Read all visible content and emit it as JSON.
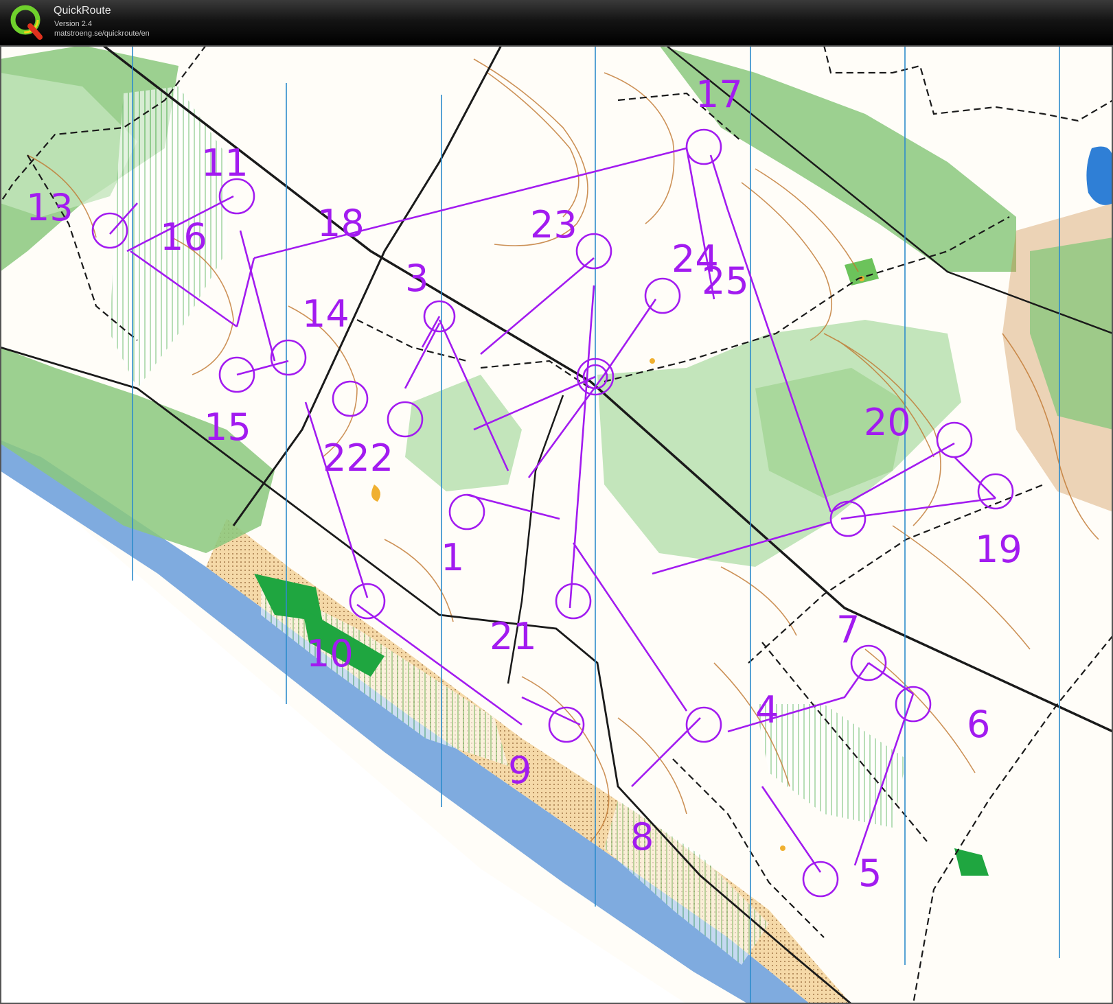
{
  "app": {
    "name": "QuickRoute",
    "version": "Version 2.4",
    "url": "matstroeng.se/quickroute/en",
    "logo_letter": "Q"
  },
  "map": {
    "control_labels": [
      "1",
      "3",
      "4",
      "5",
      "6",
      "7",
      "8",
      "9",
      "10",
      "11",
      "13",
      "14",
      "15",
      "16",
      "17",
      "18",
      "19",
      "20",
      "21",
      "222",
      "23",
      "24",
      "25"
    ],
    "colors": {
      "course": "#a21bf0",
      "water": "#7fabdf",
      "vegetation": "#8bc87e",
      "light_vegetation": "#c3e5bb",
      "contour": "#c0772f",
      "sand": "#f3c98c",
      "meridian": "#2d8ccc",
      "path": "#1a1a1a"
    }
  }
}
